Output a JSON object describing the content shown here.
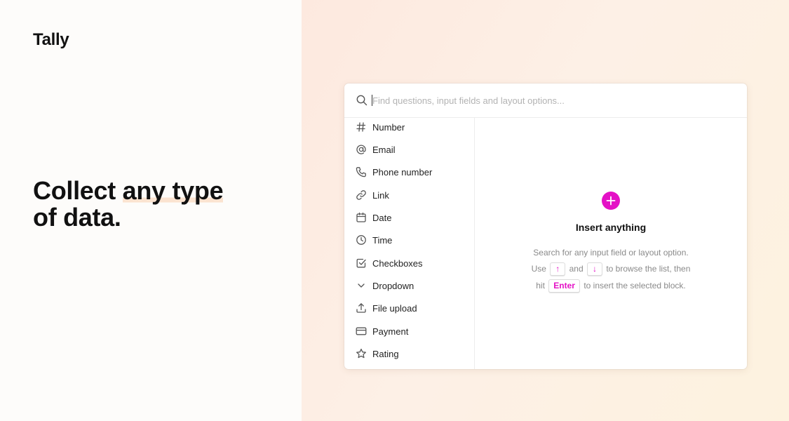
{
  "brand": {
    "logo": "Tally"
  },
  "hero": {
    "line1_start": "Collect ",
    "line1_highlight": "any type",
    "line2": "of data."
  },
  "search": {
    "placeholder": "Find questions, input fields and layout options...",
    "value": ""
  },
  "menu": {
    "items": [
      {
        "label": "Number",
        "icon": "hash-icon"
      },
      {
        "label": "Email",
        "icon": "at-sign-icon"
      },
      {
        "label": "Phone number",
        "icon": "phone-icon"
      },
      {
        "label": "Link",
        "icon": "link-icon"
      },
      {
        "label": "Date",
        "icon": "calendar-icon"
      },
      {
        "label": "Time",
        "icon": "clock-icon"
      },
      {
        "label": "Checkboxes",
        "icon": "checkbox-icon"
      },
      {
        "label": "Dropdown",
        "icon": "chevron-down-icon"
      },
      {
        "label": "File upload",
        "icon": "upload-icon"
      },
      {
        "label": "Payment",
        "icon": "credit-card-icon"
      },
      {
        "label": "Rating",
        "icon": "star-icon"
      }
    ]
  },
  "detail": {
    "title": "Insert anything",
    "line1": "Search for any input field or layout option.",
    "line2_pre": "Use",
    "key_up": "↑",
    "line2_and": "and",
    "key_down": "↓",
    "line2_post": "to browse the list, then",
    "line3_pre": "hit",
    "key_enter": "Enter",
    "line3_post": "to insert the selected block."
  },
  "colors": {
    "accent": "#e411c6",
    "highlight": "#fbe3d0",
    "panel_bg": "#ffffff",
    "backdrop": "#fdeee3"
  }
}
